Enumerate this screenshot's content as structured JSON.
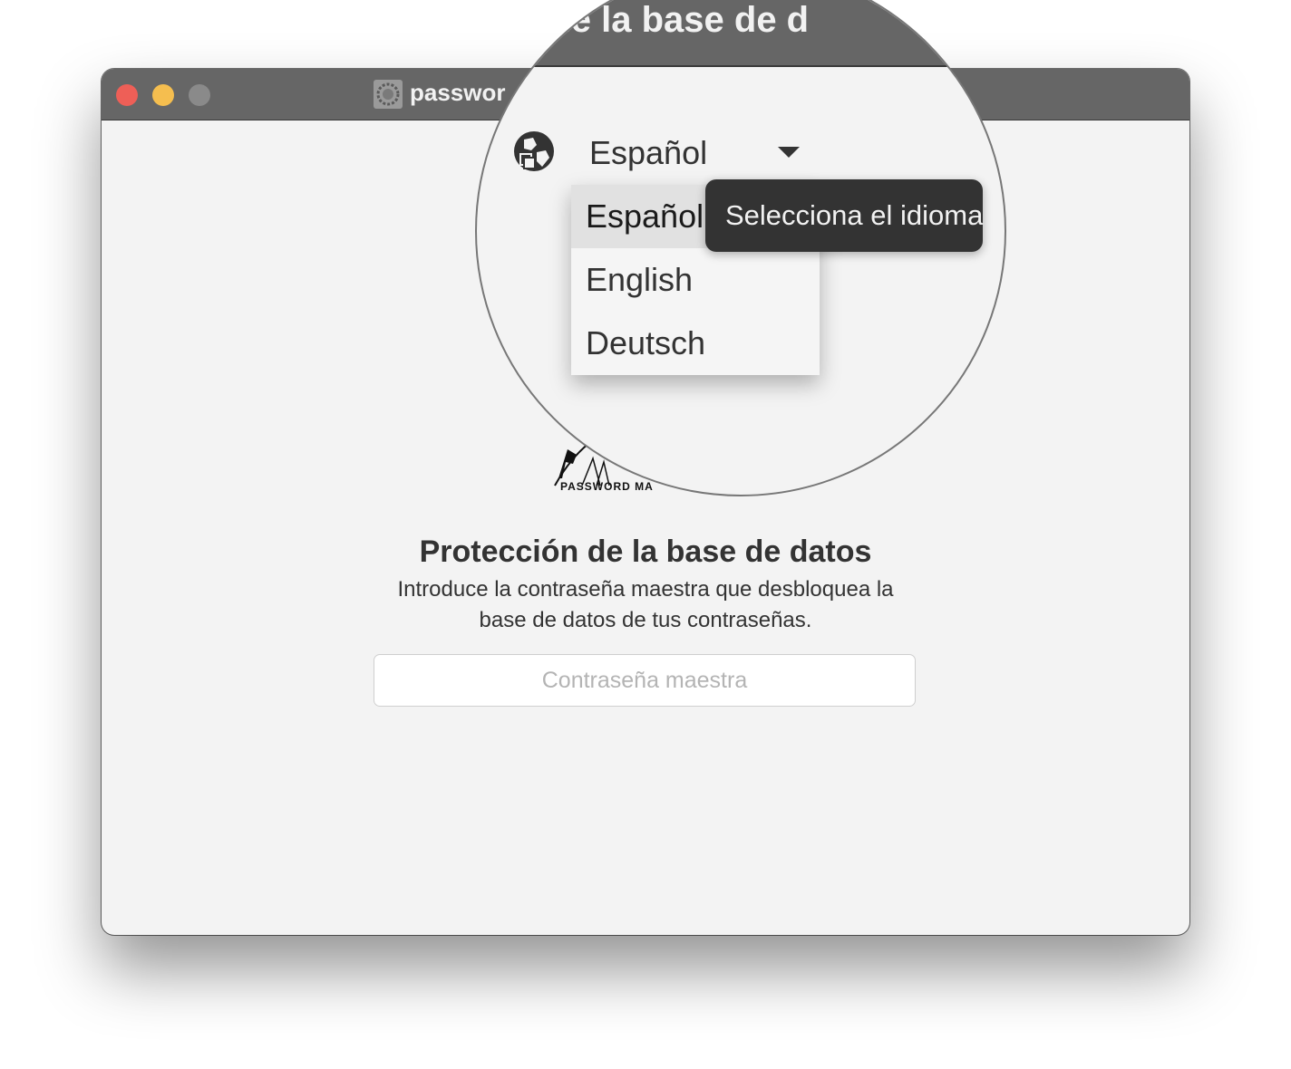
{
  "window": {
    "title": "passwor",
    "traffic_lights": {
      "close": "#ee5f57",
      "minimize": "#f5be4f",
      "maximize": "#8a8a8a"
    }
  },
  "logo": {
    "text": "PASSWORD MA"
  },
  "main": {
    "heading": "Protección de la base de datos",
    "description": "Introduce la contraseña maestra que desbloquea la base de datos de tus contraseñas.",
    "password": {
      "placeholder": "Contraseña maestra",
      "value": ""
    }
  },
  "magnifier": {
    "title_fragment": "ción de la base de d",
    "language_icon": "globe-icon",
    "language_select": {
      "selected": "Español",
      "options": [
        "Español",
        "English",
        "Deutsch"
      ]
    },
    "tooltip": "Selecciona el idioma"
  }
}
